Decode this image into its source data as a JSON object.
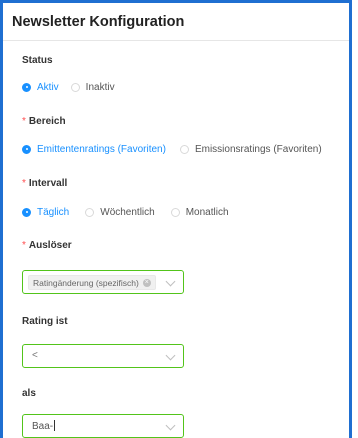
{
  "form": {
    "title": "Newsletter Konfiguration",
    "status": {
      "label": "Status",
      "options": [
        "Aktiv",
        "Inaktiv"
      ],
      "selected": "Aktiv"
    },
    "bereich": {
      "label": "Bereich",
      "required_mark": "*",
      "options": [
        "Emittentenratings (Favoriten)",
        "Emissionsratings (Favoriten)"
      ],
      "selected": "Emittentenratings (Favoriten)"
    },
    "intervall": {
      "label": "Intervall",
      "required_mark": "*",
      "options": [
        "Täglich",
        "Wöchentlich",
        "Monatlich"
      ],
      "selected": "Täglich"
    },
    "ausloeser": {
      "label": "Auslöser",
      "required_mark": "*",
      "tag": "Ratingänderung (spezifisch)",
      "tag_close": "×"
    },
    "rating_ist": {
      "label": "Rating ist",
      "value": "<"
    },
    "als": {
      "label": "als",
      "value": "Baa-"
    }
  },
  "colors": {
    "accent": "#1890ff",
    "frame": "#1f6fd1",
    "valid_border": "#52c41a",
    "required": "#ff4d4f"
  }
}
